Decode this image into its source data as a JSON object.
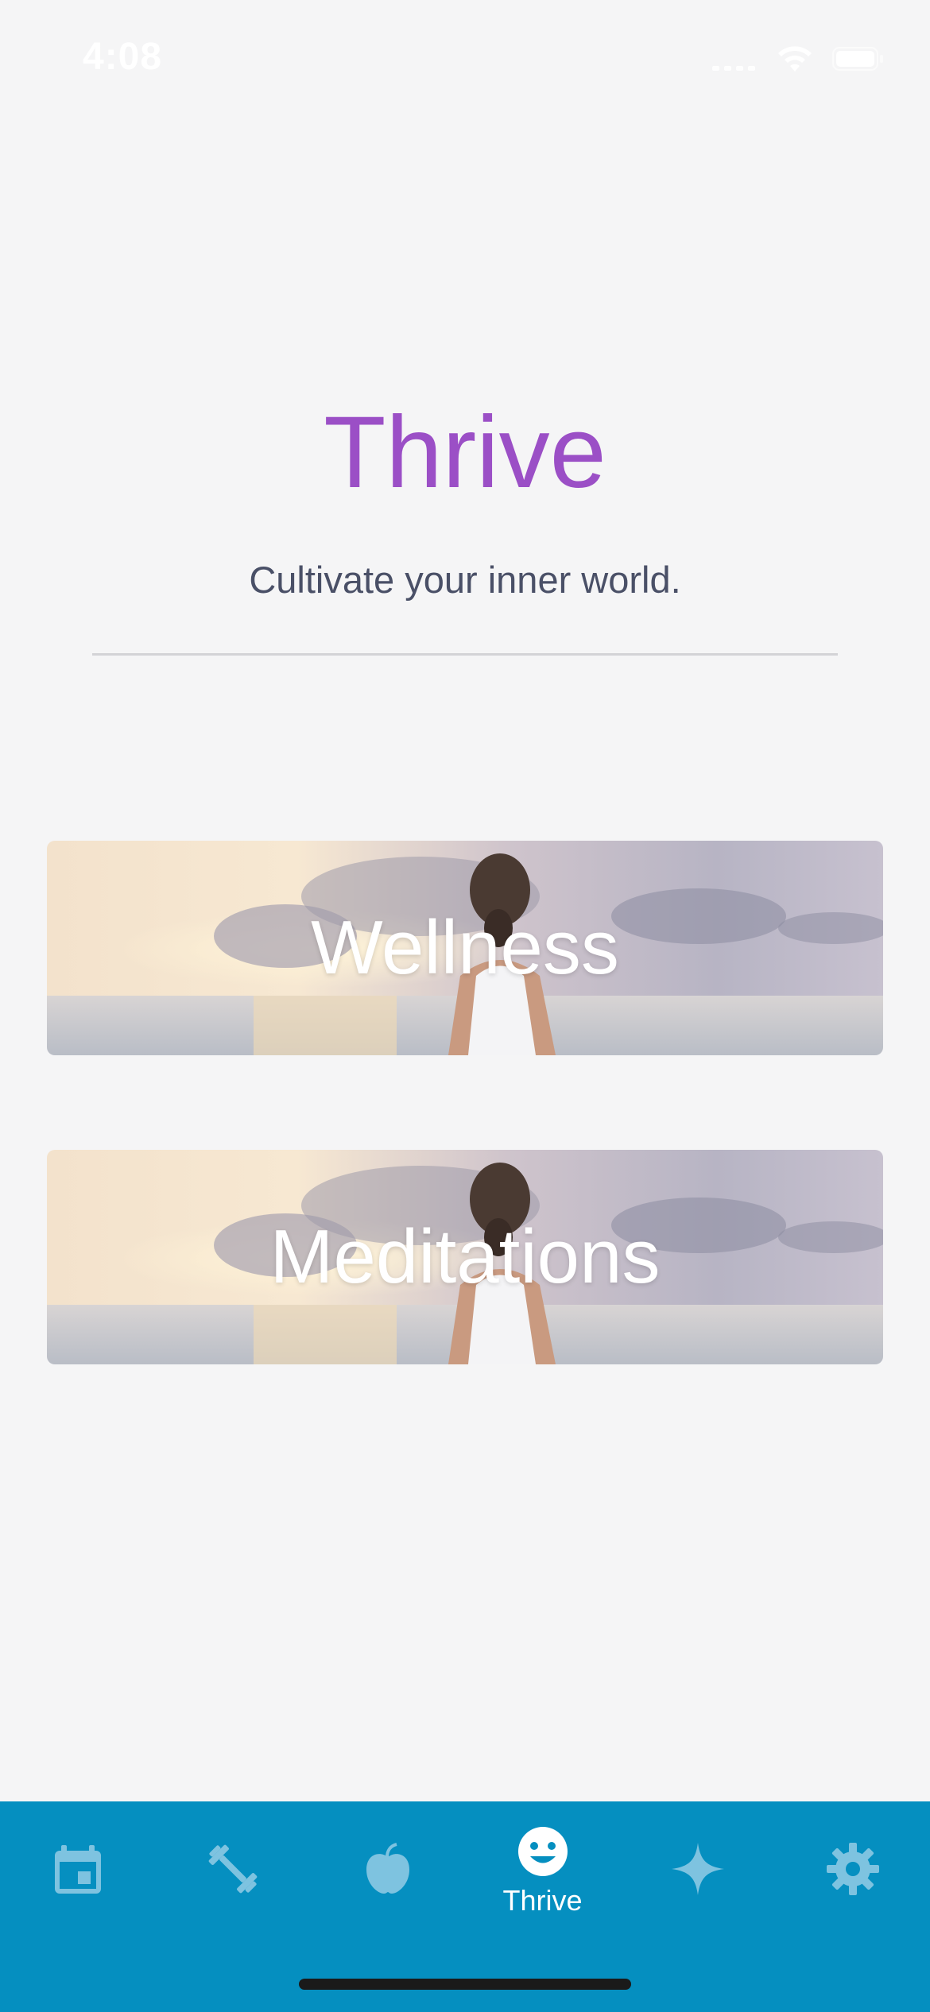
{
  "status_bar": {
    "time": "4:08"
  },
  "header": {
    "title": "Thrive",
    "subtitle": "Cultivate your inner world."
  },
  "cards": [
    {
      "label": "Wellness"
    },
    {
      "label": "Meditations"
    }
  ],
  "tab_bar": {
    "tabs": [
      {
        "icon": "calendar-icon",
        "label": "",
        "active": false
      },
      {
        "icon": "dumbbell-icon",
        "label": "",
        "active": false
      },
      {
        "icon": "apple-icon",
        "label": "",
        "active": false
      },
      {
        "icon": "smiley-icon",
        "label": "Thrive",
        "active": true
      },
      {
        "icon": "sparkle-icon",
        "label": "",
        "active": false
      },
      {
        "icon": "gear-icon",
        "label": "",
        "active": false
      }
    ]
  },
  "colors": {
    "background": "#f5f5f6",
    "title": "#9b4fc6",
    "subtitle": "#4a5067",
    "tab_bar": "#058fc0",
    "tab_icon_inactive": "#7ec3e0",
    "tab_icon_active": "#ffffff"
  }
}
